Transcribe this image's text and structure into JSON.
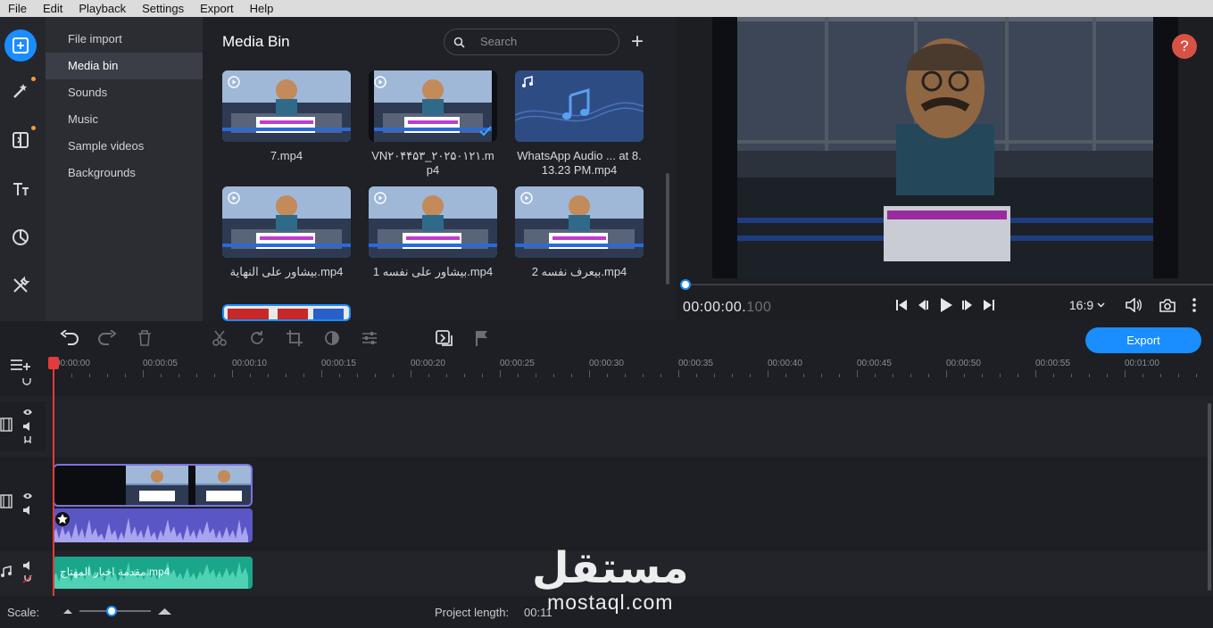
{
  "menu": [
    "File",
    "Edit",
    "Playback",
    "Settings",
    "Export",
    "Help"
  ],
  "rail": [
    {
      "icon": "media-import-icon",
      "active": true
    },
    {
      "icon": "magic-wand-icon",
      "dot": true
    },
    {
      "icon": "transitions-icon",
      "dot": true
    },
    {
      "icon": "titles-icon"
    },
    {
      "icon": "stickers-icon"
    },
    {
      "icon": "tools-icon"
    }
  ],
  "nav": [
    {
      "label": "File import"
    },
    {
      "label": "Media bin",
      "active": true
    },
    {
      "label": "Sounds"
    },
    {
      "label": "Music"
    },
    {
      "label": "Sample videos"
    },
    {
      "label": "Backgrounds"
    }
  ],
  "bin": {
    "title": "Media Bin",
    "search_placeholder": "Search",
    "items": [
      {
        "caption": "7.mp4",
        "kind": "video"
      },
      {
        "caption": "VN۲۰۴۴۵۳_۲۰۲۵۰۱۲۱.mp4",
        "kind": "video",
        "checked": true
      },
      {
        "caption": "WhatsApp Audio ... at 8.13.23 PM.mp4",
        "kind": "audio"
      },
      {
        "caption": "بيشاور على النهاية.mp4",
        "kind": "video"
      },
      {
        "caption": "بيشاور على نفسه 1.mp4",
        "kind": "video"
      },
      {
        "caption": "بيعرف نفسه 2.mp4",
        "kind": "video"
      }
    ]
  },
  "preview": {
    "help": "?",
    "timecode": "00:00:00.",
    "timecode_ms": "100",
    "aspect": "16:9"
  },
  "toolbar": {
    "export_label": "Export"
  },
  "ruler": [
    "00:00:00",
    "00:00:05",
    "00:00:10",
    "00:00:15",
    "00:00:20",
    "00:00:25",
    "00:00:30",
    "00:00:35",
    "00:00:40",
    "00:00:45",
    "00:00:50",
    "00:00:55",
    "00:01:00"
  ],
  "timeline": {
    "music_clip": "مقدمة اخبار المهتاج.mp4"
  },
  "status": {
    "scale_label": "Scale:",
    "project_length_label": "Project length:",
    "project_length": "00:11",
    "scale_value": 0.45
  },
  "watermark": {
    "arabic": "مستقل",
    "latin": "mostaql.com"
  }
}
